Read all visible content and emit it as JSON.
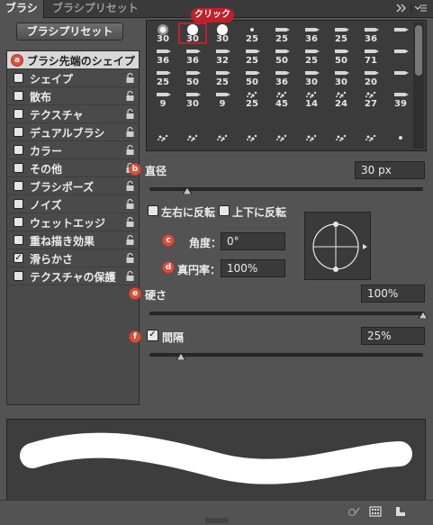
{
  "tabs": [
    {
      "label": "ブラシ",
      "active": true
    },
    {
      "label": "ブラシプリセット",
      "active": false
    }
  ],
  "tab_menu_icons": [
    "double-chevron-right-icon",
    "panel-menu-icon"
  ],
  "preset_button": "ブラシプリセット",
  "left_list": [
    {
      "label": "ブラシ先端のシェイプ",
      "selected": true,
      "checkbox": false,
      "lock": false,
      "badge": "a"
    },
    {
      "label": "シェイプ",
      "checked": false,
      "lock": true
    },
    {
      "label": "散布",
      "checked": false,
      "lock": true
    },
    {
      "label": "テクスチャ",
      "checked": false,
      "lock": true
    },
    {
      "label": "デュアルブラシ",
      "checked": false,
      "lock": true
    },
    {
      "label": "カラー",
      "checked": false,
      "lock": true
    },
    {
      "label": "その他",
      "checked": false,
      "lock": true
    },
    {
      "label": "ブラシポーズ",
      "checked": false,
      "lock": true
    },
    {
      "label": "ノイズ",
      "checked": false,
      "lock": true
    },
    {
      "label": "ウェットエッジ",
      "checked": false,
      "lock": true
    },
    {
      "label": "重ね描き効果",
      "checked": false,
      "lock": true
    },
    {
      "label": "滑らかさ",
      "checked": true,
      "lock": true
    },
    {
      "label": "テクスチャの保護",
      "checked": false,
      "lock": true
    }
  ],
  "click_tag": "クリック",
  "brush_grid": {
    "rows": [
      [
        "30",
        "30",
        "",
        "",
        "",
        "",
        "",
        "",
        "",
        ""
      ],
      [
        "",
        "",
        "",
        "",
        "",
        "",
        "",
        "",
        "",
        ""
      ],
      [
        "36",
        "36",
        "32",
        "25",
        "50",
        "25",
        "50",
        "71"
      ],
      [
        "25",
        "50",
        "25",
        "50",
        "36",
        "30",
        "30",
        "20"
      ],
      [
        "9",
        "30",
        "9",
        "25",
        "45",
        "14",
        "24",
        "27",
        "39"
      ],
      [
        "",
        "",
        "",
        "",
        "",
        "",
        "",
        "",
        ""
      ]
    ],
    "row1_numbers": [
      "30",
      "30",
      "30",
      "25",
      "25",
      "36",
      "25",
      "36"
    ],
    "row2_numbers": [
      "",
      "",
      "",
      "",
      "",
      "",
      "",
      ""
    ],
    "numbers": [
      [
        "30",
        "30",
        "30",
        "25",
        "25",
        "36",
        "25",
        "36"
      ],
      [
        "36",
        "36",
        "32",
        "25",
        "50",
        "25",
        "50",
        "71"
      ],
      [
        "25",
        "50",
        "25",
        "50",
        "36",
        "30",
        "30",
        "20"
      ],
      [
        "9",
        "30",
        "9",
        "25",
        "45",
        "14",
        "24",
        "27",
        "39"
      ]
    ],
    "selected_index": 1
  },
  "diameter": {
    "label": "直径",
    "value": "30 px",
    "badge": "b"
  },
  "flip_x": {
    "label": "左右に反転",
    "checked": false
  },
  "flip_y": {
    "label": "上下に反転",
    "checked": false
  },
  "angle": {
    "label": "角度：",
    "value": "0°",
    "badge": "c"
  },
  "roundness": {
    "label": "真円率：",
    "value": "100%",
    "badge": "d"
  },
  "hardness": {
    "label": "硬さ",
    "value": "100%",
    "badge": "e"
  },
  "spacing": {
    "label": "間隔",
    "value": "25%",
    "checked": true,
    "badge": "f"
  },
  "sliders": {
    "diameter_level": 0.14,
    "hardness_level": 1.0,
    "spacing_level": 0.12
  },
  "bottom_icons": [
    "brush-toggle-icon",
    "grid-view-icon",
    "new-preset-icon"
  ],
  "colors": {
    "panel": "#535353",
    "dark": "#3a3a3a",
    "accent": "#c0202a",
    "badge": "#d9503f"
  }
}
